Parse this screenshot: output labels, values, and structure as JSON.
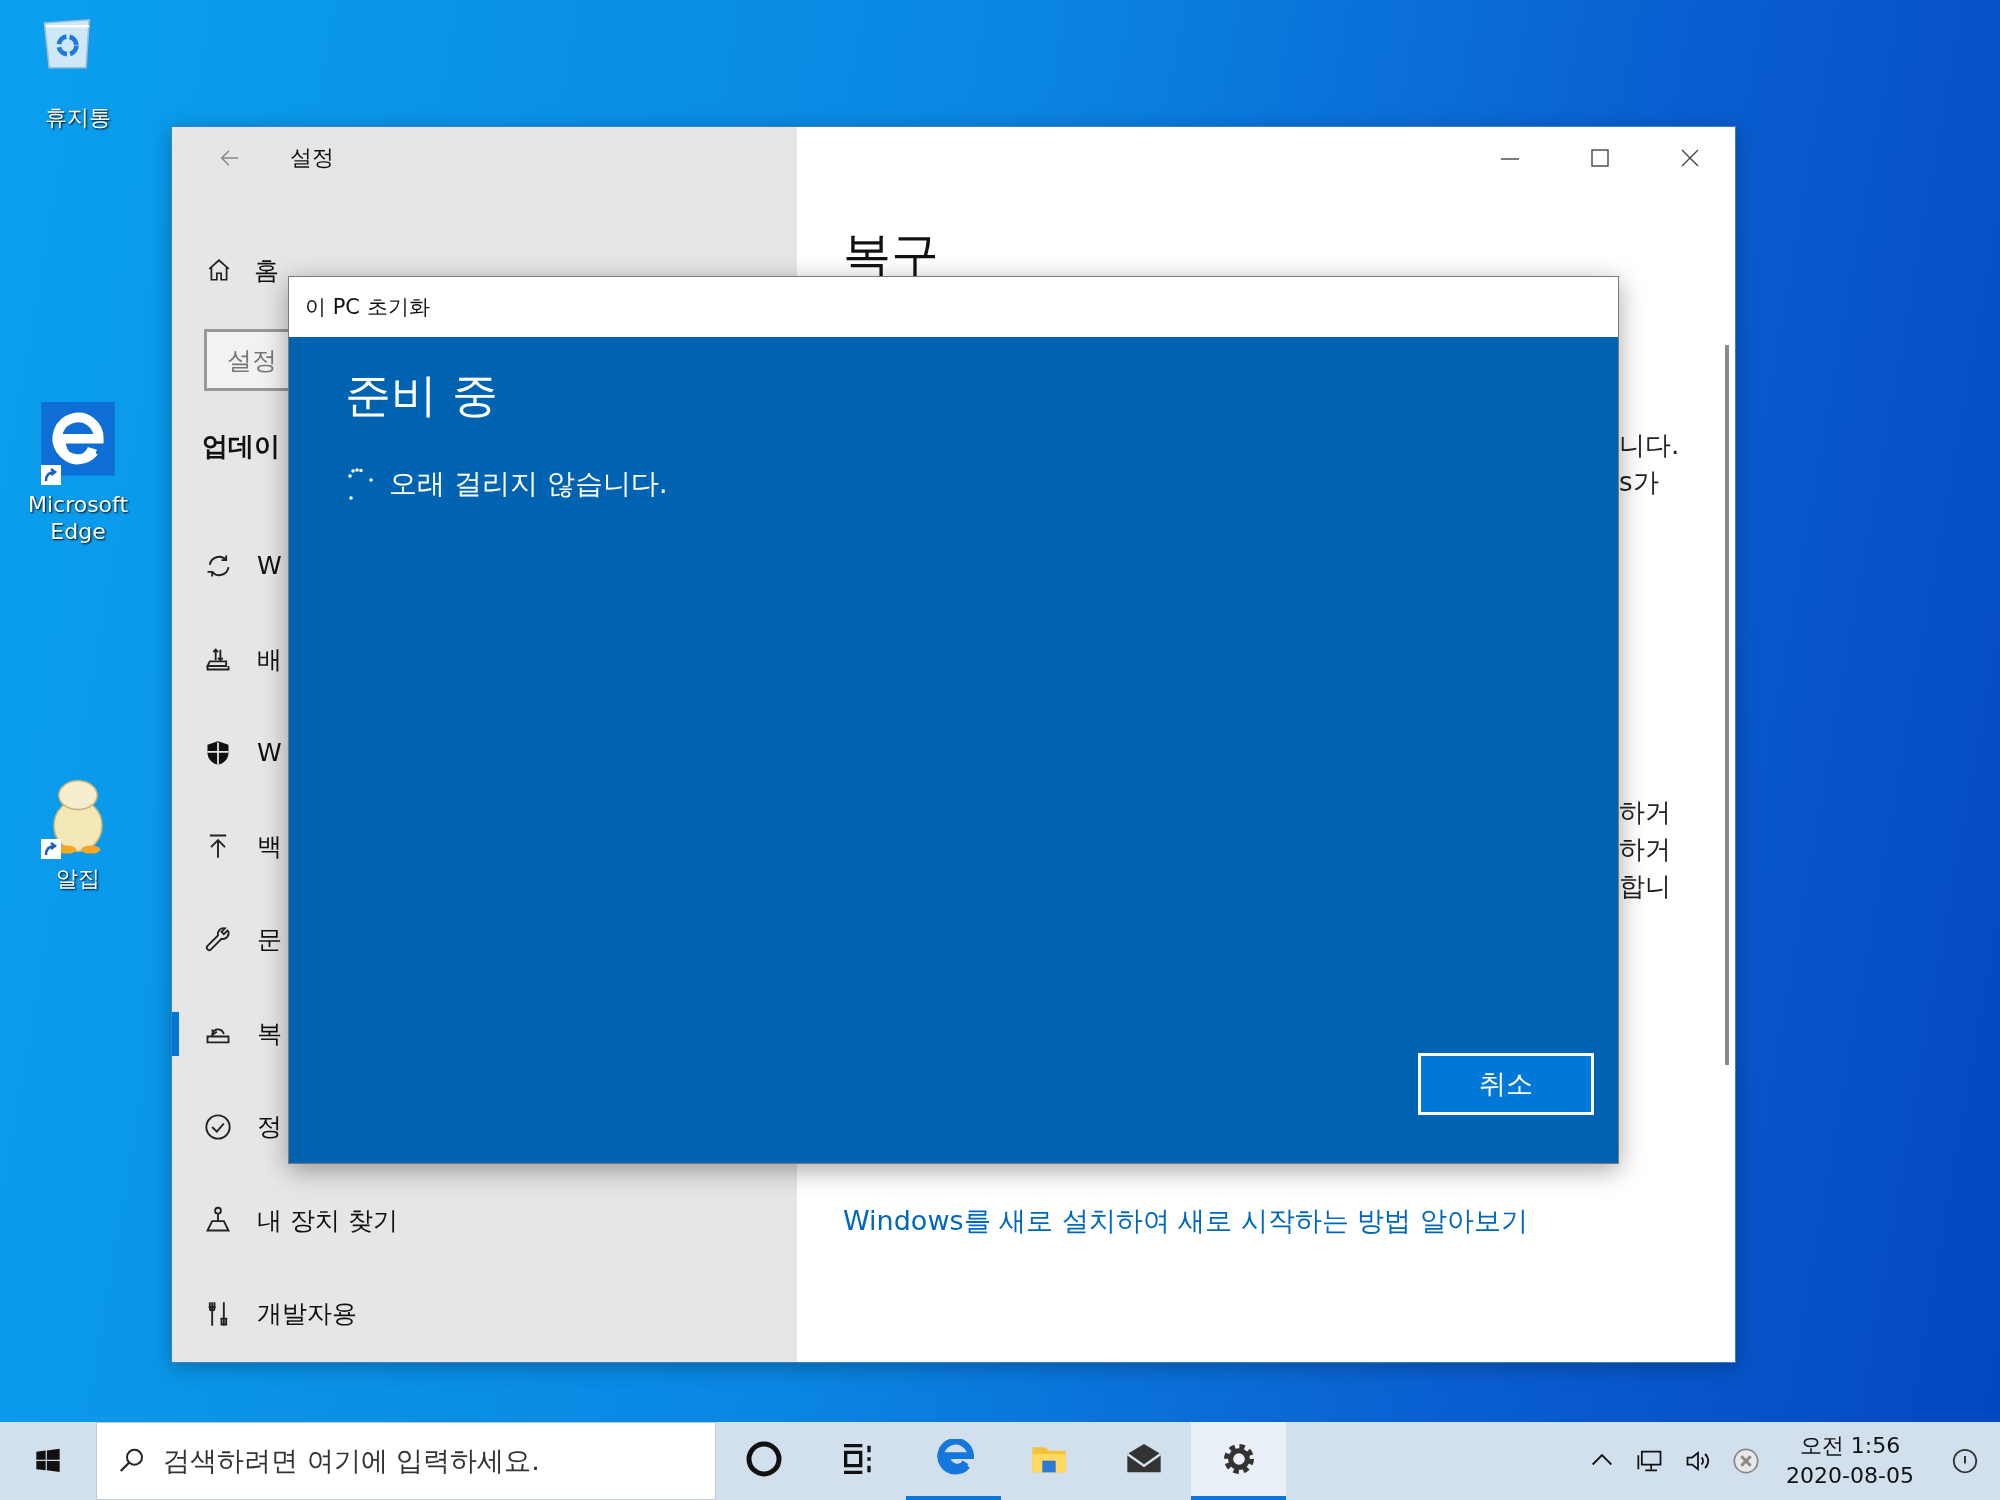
{
  "desktop": {
    "icons": [
      {
        "kind": "recycle-bin",
        "label": "휴지통",
        "shortcut": false
      },
      {
        "kind": "edge",
        "label": "Microsoft Edge",
        "shortcut": true
      },
      {
        "kind": "egg",
        "label": "알집",
        "shortcut": true
      }
    ]
  },
  "settings_window": {
    "title": "설정",
    "home": "홈",
    "search": {
      "placeholder": "설정"
    },
    "section_heading": "업데이",
    "nav_items": [
      {
        "kind": "sync",
        "label": "W",
        "selected": false
      },
      {
        "kind": "delivery",
        "label": "배",
        "selected": false
      },
      {
        "kind": "shield",
        "label": "W",
        "selected": false
      },
      {
        "kind": "backup",
        "label": "백",
        "selected": false
      },
      {
        "kind": "wrench",
        "label": "문",
        "selected": false
      },
      {
        "kind": "recovery",
        "label": "복",
        "selected": true
      },
      {
        "kind": "check",
        "label": "정",
        "selected": false
      },
      {
        "kind": "find-device",
        "label": "내 장치 찾기",
        "selected": false
      },
      {
        "kind": "developer",
        "label": "개발자용",
        "selected": false
      }
    ],
    "page_heading": "복구",
    "text_fragments": [
      [
        "니다.",
        "s가"
      ],
      [
        "하거",
        "하거",
        "합니"
      ]
    ],
    "link": "Windows를 새로 설치하여 새로 시작하는 방법 알아보기"
  },
  "dialog": {
    "title": "이 PC 초기화",
    "heading": "준비 중",
    "status": "오래 걸리지 않습니다.",
    "cancel_button": "취소"
  },
  "taskbar": {
    "search": {
      "placeholder": "검색하려면 여기에 입력하세요."
    },
    "buttons": [
      {
        "kind": "cortana",
        "running": false,
        "active": false
      },
      {
        "kind": "task-view",
        "running": false,
        "active": false
      },
      {
        "kind": "edge",
        "running": true,
        "active": false
      },
      {
        "kind": "explorer",
        "running": false,
        "active": false
      },
      {
        "kind": "mail",
        "running": false,
        "active": false
      },
      {
        "kind": "settings",
        "running": true,
        "active": true
      }
    ],
    "tray": [
      {
        "kind": "caret"
      },
      {
        "kind": "network"
      },
      {
        "kind": "volume"
      },
      {
        "kind": "error"
      }
    ],
    "clock": {
      "time": "오전 1:56",
      "date": "2020-08-05"
    }
  }
}
